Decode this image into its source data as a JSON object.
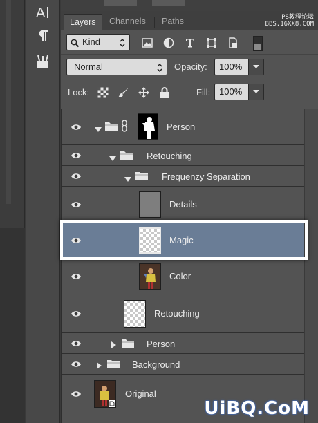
{
  "tools": [
    {
      "name": "type-tool",
      "icon": "type-tool-icon"
    },
    {
      "name": "paragraph",
      "icon": "paragraph-icon"
    },
    {
      "name": "tool-presets",
      "icon": "tool-presets-icon"
    }
  ],
  "tabs": [
    {
      "label": "Layers",
      "active": true
    },
    {
      "label": "Channels",
      "active": false
    },
    {
      "label": "Paths",
      "active": false
    }
  ],
  "watermark_top": {
    "line1": "PS教程论坛",
    "line2": "BBS.16XX8.COM"
  },
  "filter": {
    "kind_label": "Kind",
    "icons": [
      "pixel-filter-icon",
      "adjustment-filter-icon",
      "type-filter-icon",
      "shape-filter-icon",
      "smart-object-filter-icon"
    ]
  },
  "blend": {
    "mode": "Normal",
    "opacity_label": "Opacity:",
    "opacity_value": "100%"
  },
  "lock": {
    "label": "Lock:",
    "icons": [
      "lock-transparent-icon",
      "lock-pixels-icon",
      "lock-position-icon",
      "lock-all-icon"
    ],
    "fill_label": "Fill:",
    "fill_value": "100%"
  },
  "layers": [
    {
      "name": "Person",
      "type": "group-masked",
      "expanded": true,
      "indent": 0,
      "selected": false
    },
    {
      "name": "Retouching",
      "type": "group",
      "expanded": true,
      "indent": 1,
      "selected": false
    },
    {
      "name": "Frequenzy Separation",
      "type": "group",
      "expanded": true,
      "indent": 2,
      "selected": false
    },
    {
      "name": "Details",
      "type": "pixel",
      "thumb": "gray",
      "selected": false
    },
    {
      "name": "Magic",
      "type": "pixel",
      "thumb": "transparent",
      "selected": true
    },
    {
      "name": "Color",
      "type": "pixel",
      "thumb": "photo",
      "selected": false
    },
    {
      "name": "Retouching",
      "type": "pixel",
      "thumb": "transparent",
      "selected": false
    },
    {
      "name": "Person",
      "type": "group",
      "expanded": false,
      "indent": 1,
      "selected": false
    },
    {
      "name": "Background",
      "type": "group",
      "expanded": false,
      "indent": 0,
      "selected": false
    },
    {
      "name": "Original",
      "type": "smart-object",
      "thumb": "photo",
      "selected": false
    }
  ],
  "colors": {
    "panel_bg": "#535353",
    "selected_row": "#6a7d96",
    "input_bg": "#dcdcdc",
    "highlight": "#ffffff"
  },
  "watermark_bottom": "UiBQ.CoM"
}
